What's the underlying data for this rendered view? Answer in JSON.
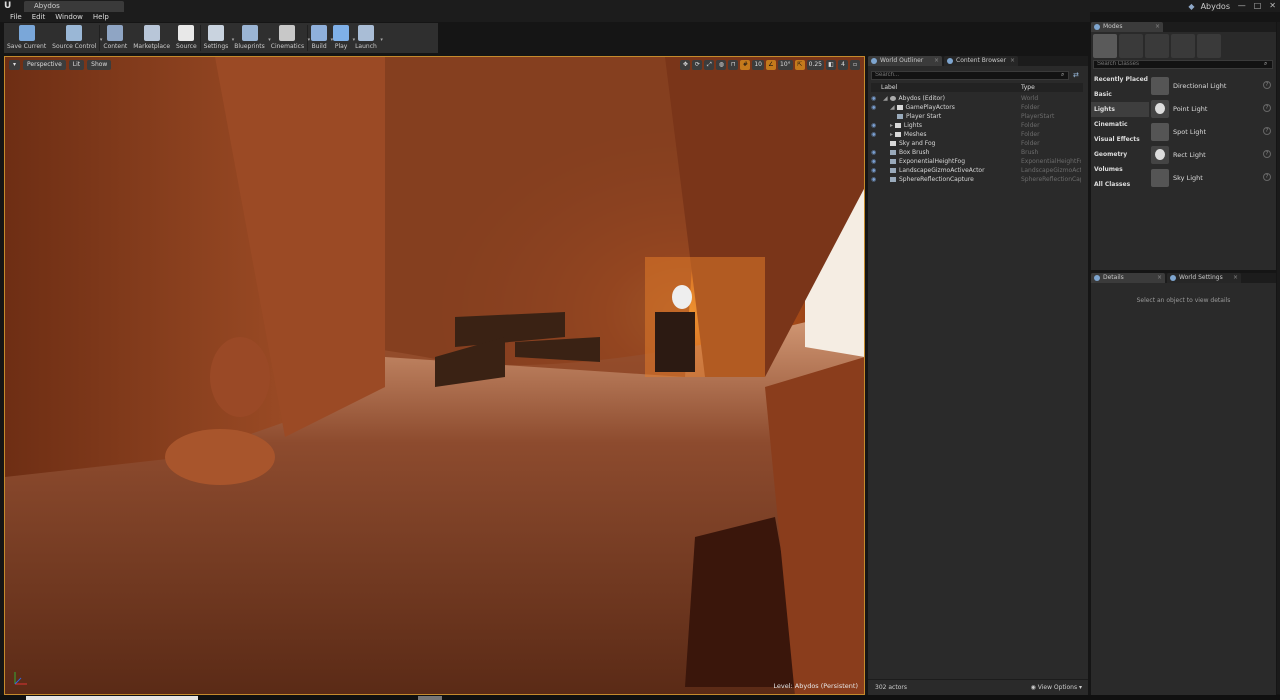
{
  "window": {
    "tab_title": "Abydos",
    "project_name": "Abydos",
    "controls": [
      "—",
      "□",
      "✕"
    ]
  },
  "menu": [
    "File",
    "Edit",
    "Window",
    "Help"
  ],
  "toolbar": [
    {
      "label": "Save Current",
      "icon": "save-icon",
      "dropdown": false
    },
    {
      "label": "Source Control",
      "icon": "source-control-icon",
      "dropdown": true
    },
    {
      "label": "Content",
      "icon": "content-icon",
      "dropdown": false
    },
    {
      "label": "Marketplace",
      "icon": "marketplace-icon",
      "dropdown": false
    },
    {
      "label": "Source",
      "icon": "source-icon",
      "dropdown": false
    },
    {
      "label": "Settings",
      "icon": "settings-icon",
      "dropdown": true
    },
    {
      "label": "Blueprints",
      "icon": "blueprints-icon",
      "dropdown": true
    },
    {
      "label": "Cinematics",
      "icon": "cinematics-icon",
      "dropdown": true
    },
    {
      "label": "Build",
      "icon": "build-icon",
      "dropdown": true
    },
    {
      "label": "Play",
      "icon": "play-icon",
      "dropdown": true
    },
    {
      "label": "Launch",
      "icon": "launch-icon",
      "dropdown": true
    }
  ],
  "viewport": {
    "perspective": "Perspective",
    "lit": "Lit",
    "show": "Show",
    "grid_snap": "10",
    "rotation_snap": "10°",
    "scale_snap": "0.25",
    "camera_speed": "4",
    "level_label": "Level:  Abydos (Persistent)"
  },
  "outliner": {
    "tab_label": "World Outliner",
    "tab2_label": "Content Browser",
    "search_placeholder": "Search...",
    "col_label": "Label",
    "col_type": "Type",
    "rows": [
      {
        "label": "Abydos (Editor)",
        "type": "World",
        "indent": 0,
        "icon": "world",
        "arrow": "◢",
        "eye": true
      },
      {
        "label": "GamePlayActors",
        "type": "Folder",
        "indent": 1,
        "icon": "folder",
        "arrow": "◢",
        "eye": true
      },
      {
        "label": "Player Start",
        "type": "PlayerStart",
        "indent": 2,
        "icon": "actor",
        "arrow": "",
        "eye": false
      },
      {
        "label": "Lights",
        "type": "Folder",
        "indent": 1,
        "icon": "folder",
        "arrow": "▸",
        "eye": true
      },
      {
        "label": "Meshes",
        "type": "Folder",
        "indent": 1,
        "icon": "folder",
        "arrow": "▸",
        "eye": true
      },
      {
        "label": "Sky and Fog",
        "type": "Folder",
        "indent": 1,
        "icon": "folder",
        "arrow": "",
        "eye": false
      },
      {
        "label": "Box Brush",
        "type": "Brush",
        "indent": 1,
        "icon": "actor",
        "arrow": "",
        "eye": true
      },
      {
        "label": "ExponentialHeightFog",
        "type": "ExponentialHeightFog",
        "indent": 1,
        "icon": "actor",
        "arrow": "",
        "eye": true
      },
      {
        "label": "LandscapeGizmoActiveActor",
        "type": "LandscapeGizmoActiveActor",
        "indent": 1,
        "icon": "actor",
        "arrow": "",
        "eye": true
      },
      {
        "label": "SphereReflectionCapture",
        "type": "SphereReflectionCapture",
        "indent": 1,
        "icon": "actor",
        "arrow": "",
        "eye": true
      }
    ],
    "actor_count": "302 actors",
    "view_options": "View Options"
  },
  "modes": {
    "tab_label": "Modes",
    "search_placeholder": "Search Classes",
    "categories": [
      "Recently Placed",
      "Basic",
      "Lights",
      "Cinematic",
      "Visual Effects",
      "Geometry",
      "Volumes",
      "All Classes"
    ],
    "active_category": "Lights",
    "items": [
      "Directional Light",
      "Point Light",
      "Spot Light",
      "Rect Light",
      "Sky Light"
    ]
  },
  "details": {
    "tab_label": "Details",
    "tab2_label": "World Settings",
    "empty_message": "Select an object to view details"
  },
  "colors": {
    "accent": "#c58a2c",
    "panel": "#2a2a2a",
    "background": "#151515"
  }
}
